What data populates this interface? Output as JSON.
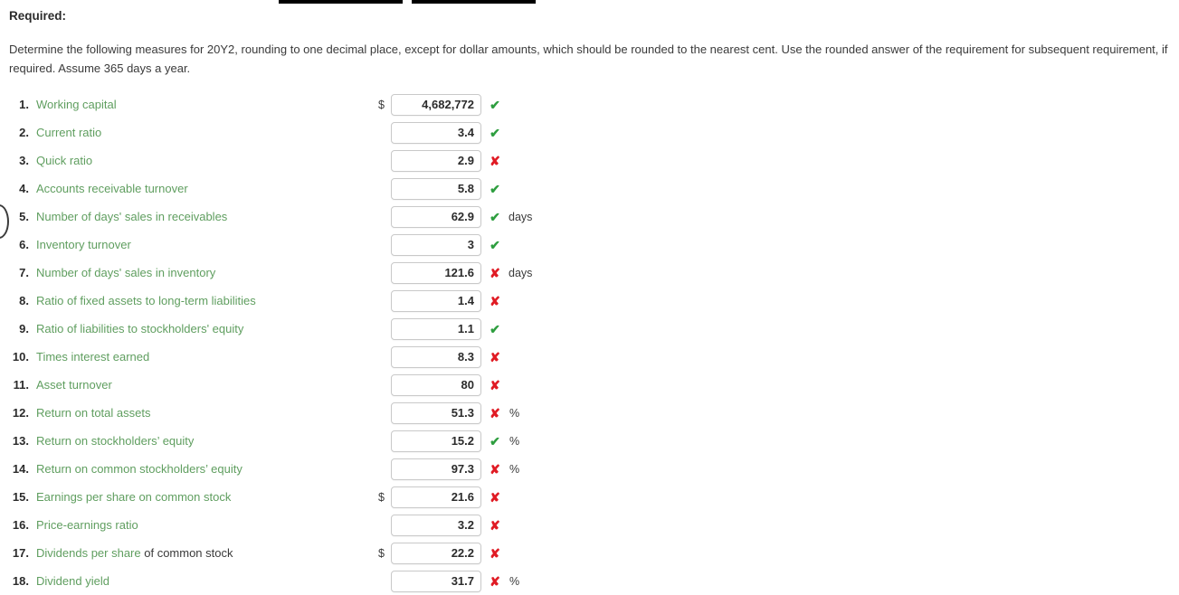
{
  "header": {
    "required_label": "Required:",
    "instructions": "Determine the following measures for 20Y2, rounding to one decimal place, except for dollar amounts, which should be rounded to the nearest cent. Use the rounded answer of the requirement for subsequent requirement, if required. Assume 365 days a year."
  },
  "icons": {
    "correct": "✔",
    "incorrect": "✘"
  },
  "colors": {
    "label_green": "#5f9e5f",
    "correct_green": "#2e9e3f",
    "incorrect_red": "#e01b24",
    "text_dark": "#2b2b2b",
    "box_border": "#c9c9c9"
  },
  "measures": [
    {
      "num": "1.",
      "label": "Working capital",
      "label_plain": "",
      "currency": "$",
      "value": "4,682,772",
      "status": "correct",
      "unit": ""
    },
    {
      "num": "2.",
      "label": "Current ratio",
      "label_plain": "",
      "currency": "",
      "value": "3.4",
      "status": "correct",
      "unit": ""
    },
    {
      "num": "3.",
      "label": "Quick ratio",
      "label_plain": "",
      "currency": "",
      "value": "2.9",
      "status": "incorrect",
      "unit": ""
    },
    {
      "num": "4.",
      "label": "Accounts receivable turnover",
      "label_plain": "",
      "currency": "",
      "value": "5.8",
      "status": "correct",
      "unit": ""
    },
    {
      "num": "5.",
      "label": "Number of days' sales in receivables",
      "label_plain": "",
      "currency": "",
      "value": "62.9",
      "status": "correct",
      "unit": "days"
    },
    {
      "num": "6.",
      "label": "Inventory turnover",
      "label_plain": "",
      "currency": "",
      "value": "3",
      "status": "correct",
      "unit": ""
    },
    {
      "num": "7.",
      "label": "Number of days' sales in inventory",
      "label_plain": "",
      "currency": "",
      "value": "121.6",
      "status": "incorrect",
      "unit": "days"
    },
    {
      "num": "8.",
      "label": "Ratio of fixed assets to long-term liabilities",
      "label_plain": "",
      "currency": "",
      "value": "1.4",
      "status": "incorrect",
      "unit": ""
    },
    {
      "num": "9.",
      "label": "Ratio of liabilities to stockholders' equity",
      "label_plain": "",
      "currency": "",
      "value": "1.1",
      "status": "correct",
      "unit": ""
    },
    {
      "num": "10.",
      "label": "Times interest earned",
      "label_plain": "",
      "currency": "",
      "value": "8.3",
      "status": "incorrect",
      "unit": ""
    },
    {
      "num": "11.",
      "label": "Asset turnover",
      "label_plain": "",
      "currency": "",
      "value": "80",
      "status": "incorrect",
      "unit": ""
    },
    {
      "num": "12.",
      "label": "Return on total assets",
      "label_plain": "",
      "currency": "",
      "value": "51.3",
      "status": "incorrect",
      "unit": "%"
    },
    {
      "num": "13.",
      "label": "Return on stockholders’ equity",
      "label_plain": "",
      "currency": "",
      "value": "15.2",
      "status": "correct",
      "unit": "%"
    },
    {
      "num": "14.",
      "label": "Return on common stockholders’ equity",
      "label_plain": "",
      "currency": "",
      "value": "97.3",
      "status": "incorrect",
      "unit": "%"
    },
    {
      "num": "15.",
      "label": "Earnings per share on common stock",
      "label_plain": "",
      "currency": "$",
      "value": "21.6",
      "status": "incorrect",
      "unit": ""
    },
    {
      "num": "16.",
      "label": "Price-earnings ratio",
      "label_plain": "",
      "currency": "",
      "value": "3.2",
      "status": "incorrect",
      "unit": ""
    },
    {
      "num": "17.",
      "label": "Dividends per share",
      "label_plain": " of common stock",
      "currency": "$",
      "value": "22.2",
      "status": "incorrect",
      "unit": ""
    },
    {
      "num": "18.",
      "label": "Dividend yield",
      "label_plain": "",
      "currency": "",
      "value": "31.7",
      "status": "incorrect",
      "unit": "%"
    }
  ]
}
